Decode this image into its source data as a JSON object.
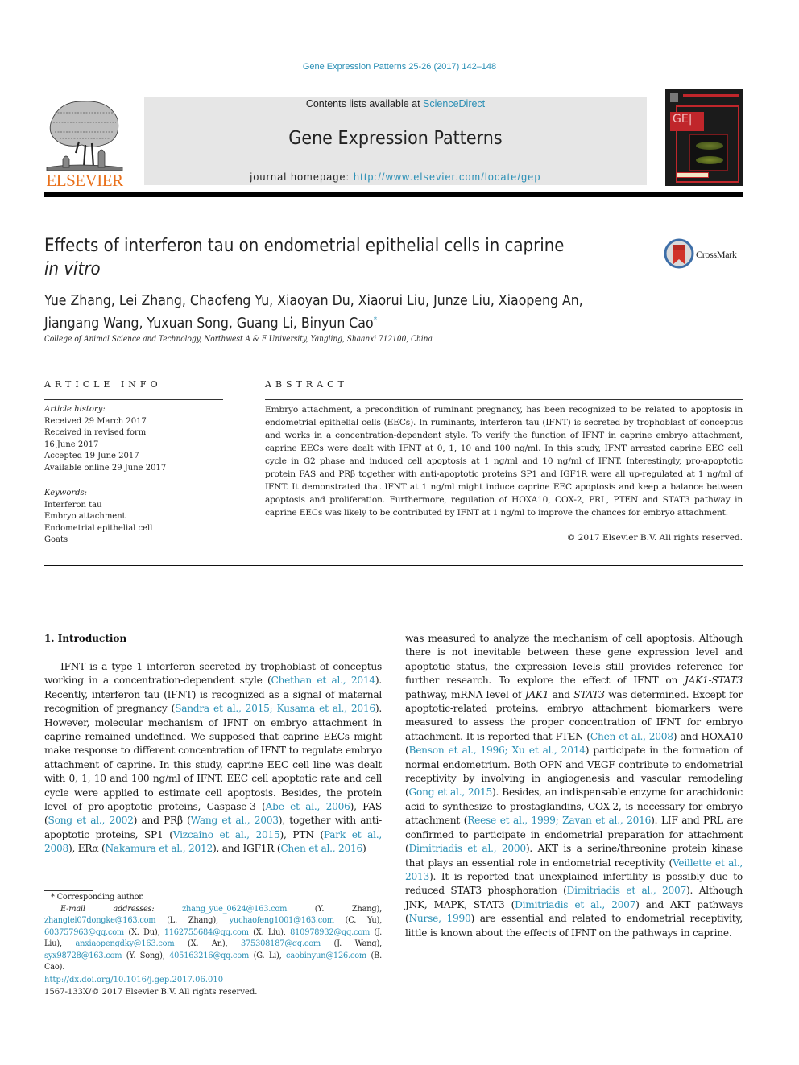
{
  "header": {
    "journal_reference": "Gene Expression Patterns 25-26 (2017) 142–148",
    "contents_prefix": "Contents lists available at ",
    "contents_link": "ScienceDirect",
    "journal_title": "Gene Expression Patterns",
    "homepage_prefix": "journal homepage: ",
    "homepage_url": "http://www.elsevier.com/locate/gep",
    "publisher_logo_text": "ELSEVIER",
    "cover_logo_text": "GE|"
  },
  "article": {
    "title_main": "Effects of interferon tau on endometrial epithelial cells in caprine",
    "title_italic": "in vitro",
    "crossmark_label": "CrossMark",
    "authors_line1": "Yue Zhang, Lei Zhang, Chaofeng Yu, Xiaoyan Du, Xiaorui Liu, Junze Liu, Xiaopeng An,",
    "authors_line2": "Jiangang Wang, Yuxuan Song, Guang Li, Binyun Cao",
    "corresponding_marker": "*",
    "affiliation": "College of Animal Science and Technology, Northwest A & F University, Yangling, Shaanxi 712100, China"
  },
  "article_info": {
    "heading": "ARTICLE INFO",
    "history_label": "Article history:",
    "history": [
      "Received 29 March 2017",
      "Received in revised form",
      "16 June 2017",
      "Accepted 19 June 2017",
      "Available online 29 June 2017"
    ],
    "keywords_label": "Keywords:",
    "keywords": [
      "Interferon tau",
      "Embryo attachment",
      "Endometrial epithelial cell",
      "Goats"
    ]
  },
  "abstract": {
    "heading": "ABSTRACT",
    "text": "Embryo attachment, a precondition of ruminant pregnancy, has been recognized to be related to apoptosis in endometrial epithelial cells (EECs). In ruminants, interferon tau (IFNT) is secreted by trophoblast of conceptus and works in a concentration-dependent style. To verify the function of IFNT in caprine embryo attachment, caprine EECs were dealt with IFNT at 0, 1, 10 and 100 ng/ml. In this study, IFNT arrested caprine EEC cell cycle in G2 phase and induced cell apoptosis at 1 ng/ml and 10 ng/ml of IFNT. Interestingly, pro-apoptotic protein FAS and PRβ together with anti-apoptotic proteins SP1 and IGF1R were all up-regulated at 1 ng/ml of IFNT. It demonstrated that IFNT at 1 ng/ml might induce caprine EEC apoptosis and keep a balance between apoptosis and proliferation. Furthermore, regulation of HOXA10, COX-2, PRL, PTEN and STAT3 pathway in caprine EECs was likely to be contributed by IFNT at 1 ng/ml to improve the chances for embryo attachment.",
    "copyright": "© 2017 Elsevier B.V. All rights reserved."
  },
  "introduction": {
    "heading": "1.  Introduction",
    "left": [
      {
        "t": "IFNT is a type 1 interferon secreted by trophoblast of conceptus working in a concentration-dependent style ("
      },
      {
        "c": "Chethan et al., 2014"
      },
      {
        "t": "). Recently, interferon tau (IFNT) is recognized as a signal of maternal recognition of pregnancy ("
      },
      {
        "c": "Sandra et al., 2015; Kusama et al., 2016"
      },
      {
        "t": "). However, molecular mechanism of IFNT on embryo attachment in caprine remained undefined. We supposed that caprine EECs might make response to different concentration of IFNT to regulate embryo attachment of caprine. In this study, caprine EEC cell line was dealt with 0, 1, 10 and 100 ng/ml of IFNT. EEC cell apoptotic rate and cell cycle were applied to estimate cell apoptosis. Besides, the protein level of pro-apoptotic proteins, Caspase-3 ("
      },
      {
        "c": "Abe et al., 2006"
      },
      {
        "t": "), FAS ("
      },
      {
        "c": "Song et al., 2002"
      },
      {
        "t": ") and PRβ ("
      },
      {
        "c": "Wang et al., 2003"
      },
      {
        "t": "), together with anti-apoptotic proteins, SP1 ("
      },
      {
        "c": "Vizcaino et al., 2015"
      },
      {
        "t": "), PTN ("
      },
      {
        "c": "Park et al., 2008"
      },
      {
        "t": "), ERα ("
      },
      {
        "c": "Nakamura et al., 2012"
      },
      {
        "t": "), and IGF1R ("
      },
      {
        "c": "Chen et al., 2016"
      },
      {
        "t": ")"
      }
    ],
    "right": [
      {
        "t": "was measured to analyze the mechanism of cell apoptosis. Although there is not inevitable between these gene expression level and apoptotic status, the expression levels still provides reference for further research. To explore the effect of IFNT on "
      },
      {
        "i": "JAK1-STAT3"
      },
      {
        "t": " pathway, mRNA level of "
      },
      {
        "i": "JAK1"
      },
      {
        "t": " and "
      },
      {
        "i": "STAT3"
      },
      {
        "t": " was determined. Except for apoptotic-related proteins, embryo attachment biomarkers were measured to assess the proper concentration of IFNT for embryo attachment. It is reported that PTEN ("
      },
      {
        "c": "Chen et al., 2008"
      },
      {
        "t": ") and HOXA10 ("
      },
      {
        "c": "Benson et al., 1996; Xu et al., 2014"
      },
      {
        "t": ") participate in the formation of normal endometrium. Both OPN and VEGF contribute to endometrial receptivity by involving in angiogenesis and vascular remodeling ("
      },
      {
        "c": "Gong et al., 2015"
      },
      {
        "t": "). Besides, an indispensable enzyme for arachidonic acid to synthesize to prostaglandins, COX-2, is necessary for embryo attachment ("
      },
      {
        "c": "Reese et al., 1999; Zavan et al., 2016"
      },
      {
        "t": "). LIF and PRL are confirmed to participate in endometrial preparation for attachment ("
      },
      {
        "c": "Dimitriadis et al., 2000"
      },
      {
        "t": "). AKT is a serine/threonine protein kinase that plays an essential role in endometrial receptivity ("
      },
      {
        "c": "Veillette et al., 2013"
      },
      {
        "t": "). It is reported that unexplained infertility is possibly due to reduced STAT3 phosphoration ("
      },
      {
        "c": "Dimitriadis et al., 2007"
      },
      {
        "t": "). Although JNK, MAPK, STAT3 ("
      },
      {
        "c": "Dimitriadis et al., 2007"
      },
      {
        "t": ") and AKT pathways ("
      },
      {
        "c": "Nurse, 1990"
      },
      {
        "t": ") are essential and related to endometrial receptivity, little is known about the effects of IFNT on the pathways in caprine."
      }
    ]
  },
  "footnotes": {
    "corresponding": "* Corresponding author.",
    "email_label": "E-mail addresses: ",
    "emails": [
      {
        "email": "zhang_yue_0624@163.com",
        "name": "(Y. Zhang)"
      },
      {
        "email": "zhanglei07dongke@163.com",
        "name": "(L. Zhang)"
      },
      {
        "email": "yuchaofeng1001@163.com",
        "name": "(C. Yu)"
      },
      {
        "email": "603757963@qq.com",
        "name": "(X. Du)"
      },
      {
        "email": "1162755684@qq.com",
        "name": "(X. Liu)"
      },
      {
        "email": "810978932@qq.com",
        "name": "(J. Liu)"
      },
      {
        "email": "anxiaopengdky@163.com",
        "name": "(X. An)"
      },
      {
        "email": "375308187@qq.com",
        "name": "(J. Wang)"
      },
      {
        "email": "syx98728@163.com",
        "name": "(Y. Song)"
      },
      {
        "email": "405163216@qq.com",
        "name": "(G. Li)"
      },
      {
        "email": "caobinyun@126.com",
        "name": "(B. Cao)."
      }
    ],
    "doi": "http://dx.doi.org/10.1016/j.gep.2017.06.010",
    "issn_copyright": "1567-133X/© 2017 Elsevier B.V. All rights reserved."
  },
  "colors": {
    "link": "#2a8fb5",
    "elsevier_orange": "#e9711c",
    "masthead_bg": "#e6e6e6",
    "cover_red": "#c0262b"
  }
}
